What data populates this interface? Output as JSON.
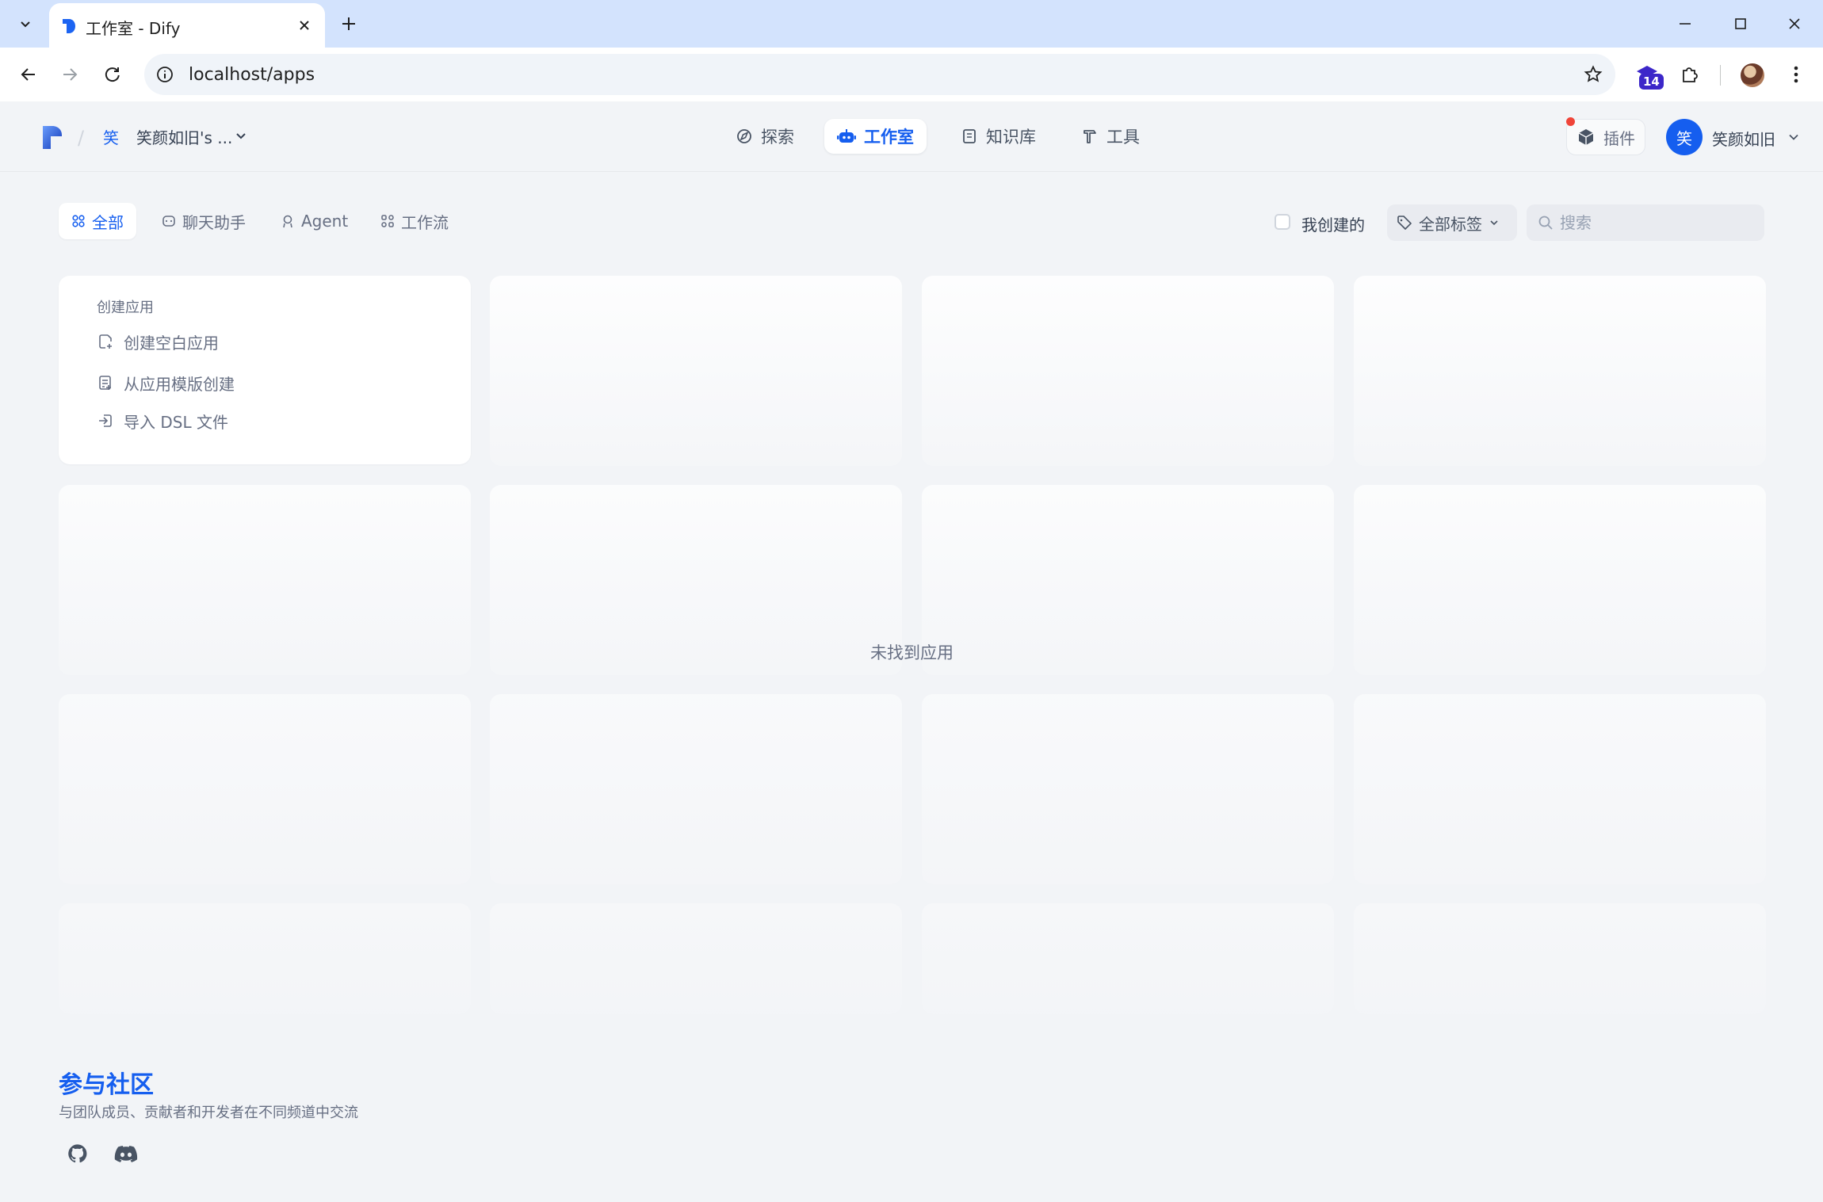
{
  "browser": {
    "tab_title": "工作室 - Dify",
    "url": "localhost/apps",
    "extension_badge": "14"
  },
  "header": {
    "workspace_icon_letter": "笑",
    "workspace_name": "笑颜如旧's ...",
    "nav": [
      {
        "label": "探索",
        "icon": "compass-icon",
        "active": false
      },
      {
        "label": "工作室",
        "icon": "robot-icon",
        "active": true
      },
      {
        "label": "知识库",
        "icon": "book-icon",
        "active": false
      },
      {
        "label": "工具",
        "icon": "hammer-icon",
        "active": false
      }
    ],
    "plugins_label": "插件",
    "user_avatar_letter": "笑",
    "user_name": "笑颜如旧"
  },
  "filters": {
    "tabs": [
      {
        "label": "全部",
        "icon": "grid-icon",
        "active": true
      },
      {
        "label": "聊天助手",
        "icon": "chat-icon",
        "active": false
      },
      {
        "label": "Agent",
        "icon": "agent-icon",
        "active": false
      },
      {
        "label": "工作流",
        "icon": "workflow-icon",
        "active": false
      }
    ],
    "created_by_me_label": "我创建的",
    "created_by_me_checked": false,
    "tags_label": "全部标签",
    "search_placeholder": "搜索"
  },
  "create_card": {
    "title": "创建应用",
    "items": [
      {
        "label": "创建空白应用",
        "icon": "new-file-icon"
      },
      {
        "label": "从应用模版创建",
        "icon": "template-icon"
      },
      {
        "label": "导入 DSL 文件",
        "icon": "import-icon"
      }
    ]
  },
  "empty_state": "未找到应用",
  "footer": {
    "title": "参与社区",
    "description": "与团队成员、贡献者和开发者在不同频道中交流",
    "links": [
      "github-icon",
      "discord-icon"
    ]
  },
  "colors": {
    "accent": "#155eef",
    "page_bg": "#f2f4f7",
    "browser_frame": "#d3e3fd",
    "notification_dot": "#f04438"
  }
}
